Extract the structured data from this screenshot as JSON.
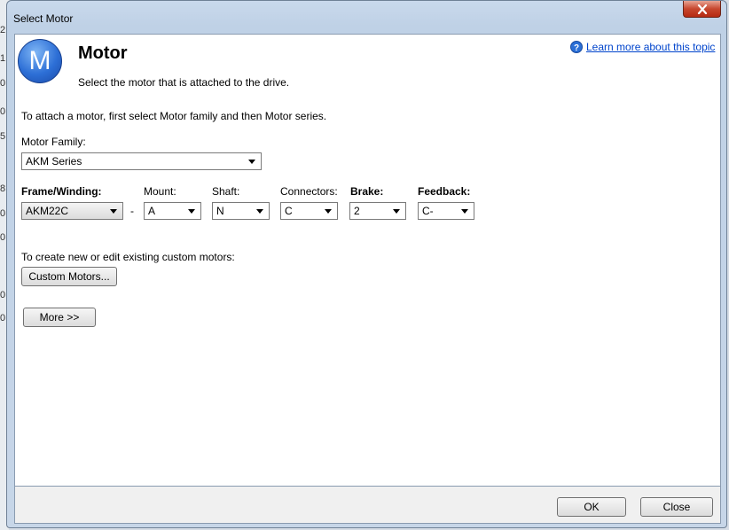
{
  "window": {
    "title": "Select Motor"
  },
  "header": {
    "logo_letter": "M",
    "title": "Motor",
    "subtitle": "Select the motor that is attached to the drive.",
    "help_link": "Learn more about this topic"
  },
  "instructions": "To attach a motor, first select Motor family and then Motor series.",
  "motor_family": {
    "label": "Motor Family:",
    "value": "AKM Series"
  },
  "fields": {
    "frame_winding": {
      "label": "Frame/Winding:",
      "value": "AKM22C"
    },
    "separator": "-",
    "mount": {
      "label": "Mount:",
      "value": "A"
    },
    "shaft": {
      "label": "Shaft:",
      "value": "N"
    },
    "connectors": {
      "label": "Connectors:",
      "value": "C"
    },
    "brake": {
      "label": "Brake:",
      "value": "2"
    },
    "feedback": {
      "label": "Feedback:",
      "value": "C-"
    }
  },
  "custom": {
    "text": "To create new or edit existing custom motors:",
    "button": "Custom Motors..."
  },
  "more_button": "More >>",
  "footer": {
    "ok": "OK",
    "close": "Close"
  },
  "background_cells": [
    "2",
    "1",
    "0",
    "0",
    "5",
    "8",
    "0",
    "0",
    "0",
    "0"
  ],
  "colors": {
    "link": "#0044cc",
    "close_button": "#c7472e",
    "logo": "#2d6fd6"
  }
}
